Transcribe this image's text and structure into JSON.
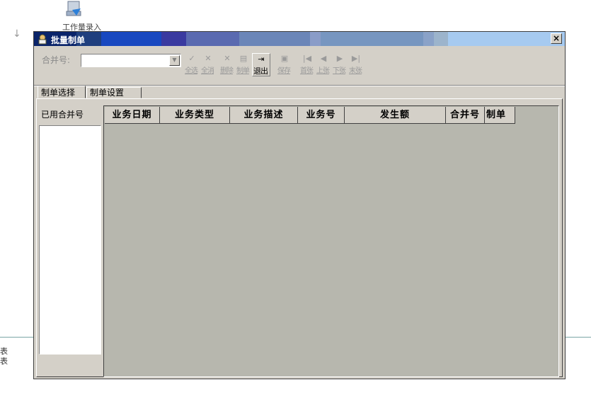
{
  "desktop": {
    "icon_label": "工作量录入",
    "left_text_1": "表",
    "left_text_2": "表"
  },
  "window": {
    "title": "批量制单",
    "close_label": "×"
  },
  "toolbar": {
    "hebing_label": "合并号:",
    "combo_value": "",
    "buttons": [
      {
        "label": "全选",
        "icon": "✓",
        "enabled": false
      },
      {
        "label": "全消",
        "icon": "✕",
        "enabled": false
      },
      {
        "label": "删除",
        "icon": "✕",
        "enabled": false
      },
      {
        "label": "制单",
        "icon": "▤",
        "enabled": false
      },
      {
        "label": "退出",
        "icon": "⇥",
        "enabled": true
      },
      {
        "label": "保存",
        "icon": "▣",
        "enabled": false
      },
      {
        "label": "首张",
        "icon": "|◀",
        "enabled": false
      },
      {
        "label": "上张",
        "icon": "◀",
        "enabled": false
      },
      {
        "label": "下张",
        "icon": "▶",
        "enabled": false
      },
      {
        "label": "末张",
        "icon": "▶|",
        "enabled": false
      }
    ]
  },
  "tabs": [
    {
      "label": "制单选择",
      "active": true
    },
    {
      "label": "制单设置",
      "active": false
    }
  ],
  "used_panel": {
    "label": "已用合并号"
  },
  "grid": {
    "columns": [
      "业务日期",
      "业务类型",
      "业务描述",
      "业务号",
      "发生额",
      "合并号",
      "制单"
    ]
  }
}
